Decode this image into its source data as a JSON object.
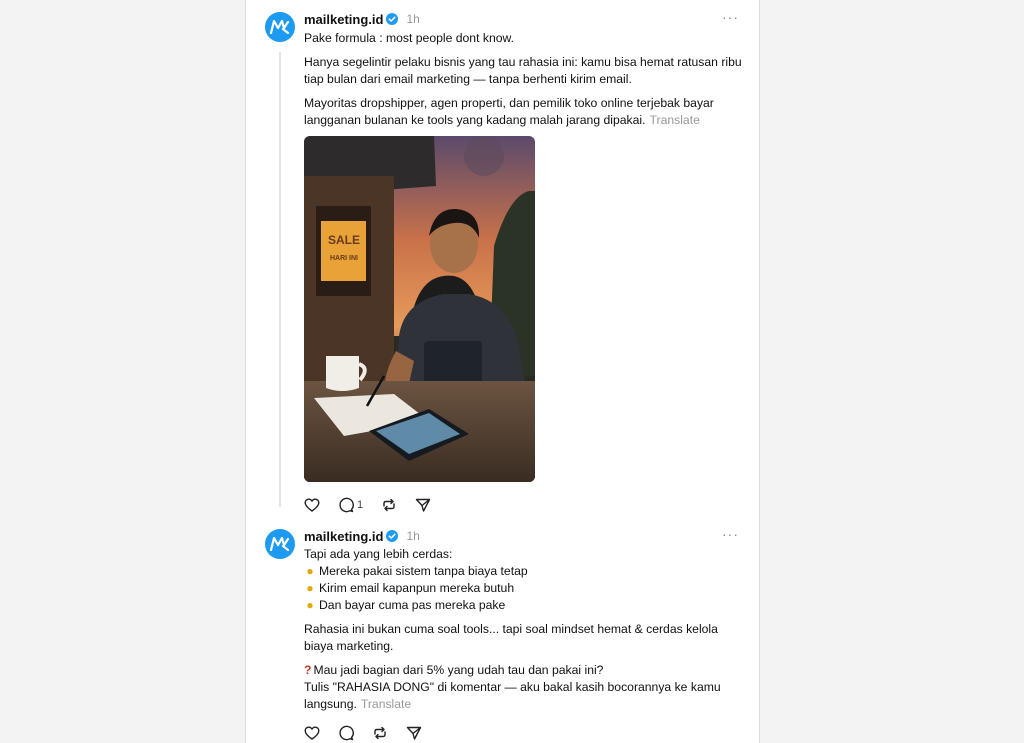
{
  "colors": {
    "accent": "#1d9bf0",
    "muted": "#999999",
    "text": "#111111"
  },
  "posts": [
    {
      "username": "mailketing.id",
      "time": "1h",
      "more": "···",
      "paragraphs": [
        "Pake formula : most people dont know.",
        "Hanya segelintir pelaku bisnis yang tau rahasia ini: kamu bisa hemat ratusan ribu tiap bulan dari email marketing — tanpa berhenti kirim email.",
        "Mayoritas dropshipper, agen properti, dan pemilik toko online terjebak bayar langganan bulanan ke tools yang kadang malah jarang dipakai."
      ],
      "translate": "Translate",
      "image_sign": {
        "line1": "SALE",
        "line2": "HARI INI"
      },
      "actions": {
        "like_icon": "heart-icon",
        "reply_icon": "comment-icon",
        "reply_count": "1",
        "repost_icon": "repost-icon",
        "share_icon": "send-icon"
      }
    },
    {
      "username": "mailketing.id",
      "time": "1h",
      "more": "···",
      "intro": "Tapi ada yang lebih cerdas:",
      "bullets": [
        "Mereka pakai sistem tanpa biaya tetap",
        "Kirim email kapanpun mereka butuh",
        "Dan bayar cuma pas mereka pake"
      ],
      "bullet_icon": "lightbulb-icon",
      "paragraph2": "Rahasia ini bukan cuma soal tools... tapi soal mindset hemat & cerdas kelola biaya marketing.",
      "question_icon": "question-mark-icon",
      "question": "Mau jadi bagian dari 5% yang udah tau dan pakai ini?",
      "cta": "Tulis \"RAHASIA DONG\" di komentar — aku bakal kasih bocorannya ke kamu langsung.",
      "translate": "Translate",
      "actions": {
        "like_icon": "heart-icon",
        "reply_icon": "comment-icon",
        "repost_icon": "repost-icon",
        "share_icon": "send-icon"
      }
    }
  ]
}
